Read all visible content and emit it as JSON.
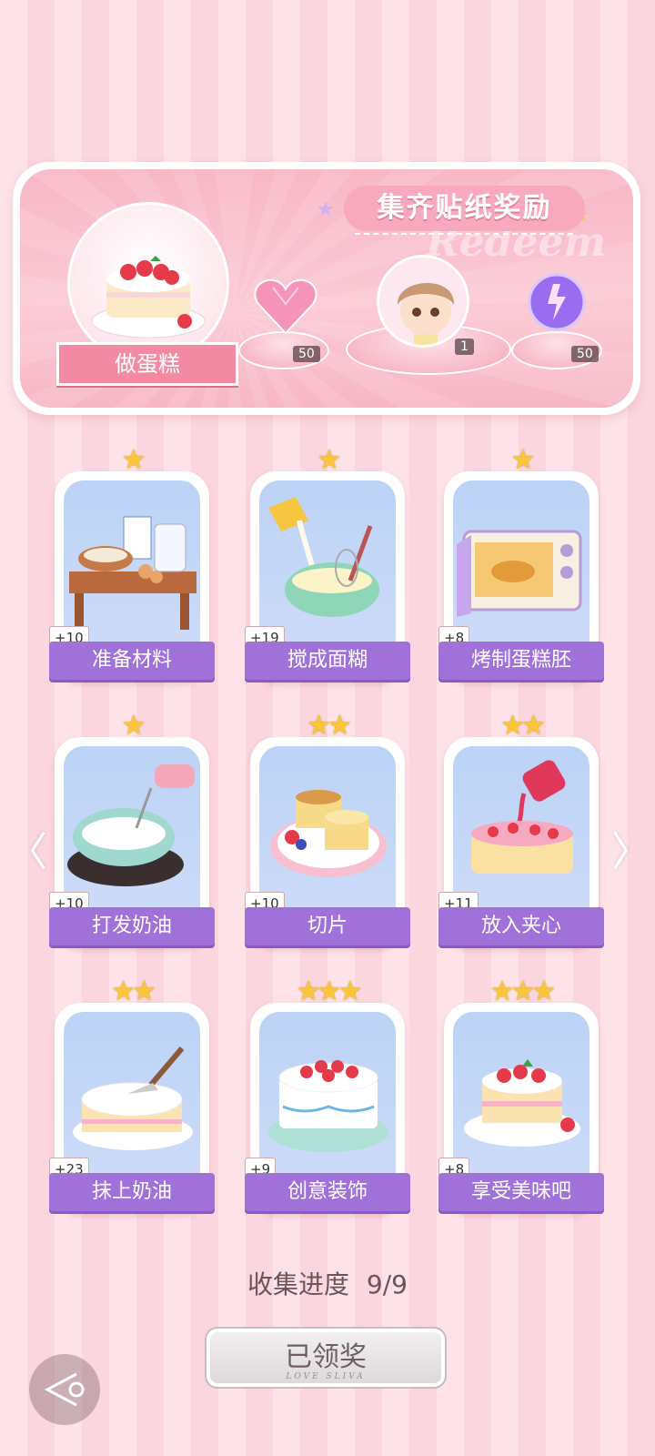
{
  "banner": {
    "title": "集齐贴纸奖励",
    "watermark": "Redeem",
    "main_label": "做蛋糕",
    "rewards": [
      {
        "icon": "pink-heart-gem-icon",
        "count": "50"
      },
      {
        "icon": "avatar-portrait",
        "count": "1"
      },
      {
        "icon": "purple-energy-orb-icon",
        "count": "50"
      }
    ]
  },
  "cards": [
    {
      "label": "准备材料",
      "count": "+10",
      "stars": "★"
    },
    {
      "label": "搅成面糊",
      "count": "+19",
      "stars": "★"
    },
    {
      "label": "烤制蛋糕胚",
      "count": "+8",
      "stars": "★"
    },
    {
      "label": "打发奶油",
      "count": "+10",
      "stars": "★"
    },
    {
      "label": "切片",
      "count": "+10",
      "stars": "★★"
    },
    {
      "label": "放入夹心",
      "count": "+11",
      "stars": "★★"
    },
    {
      "label": "抹上奶油",
      "count": "+23",
      "stars": "★★"
    },
    {
      "label": "创意装饰",
      "count": "+9",
      "stars": "★★★"
    },
    {
      "label": "享受美味吧",
      "count": "+8",
      "stars": "★★★"
    }
  ],
  "progress": {
    "label": "收集进度",
    "value": "9/9"
  },
  "claim_button": {
    "label": "已领奖",
    "sub": "LOVE SLIVA"
  },
  "nav": {
    "left": "〈",
    "right": "〉"
  },
  "colors": {
    "accent_purple": "#a071d8",
    "banner_pink": "#f8b7c6",
    "star": "#f9c63a"
  }
}
